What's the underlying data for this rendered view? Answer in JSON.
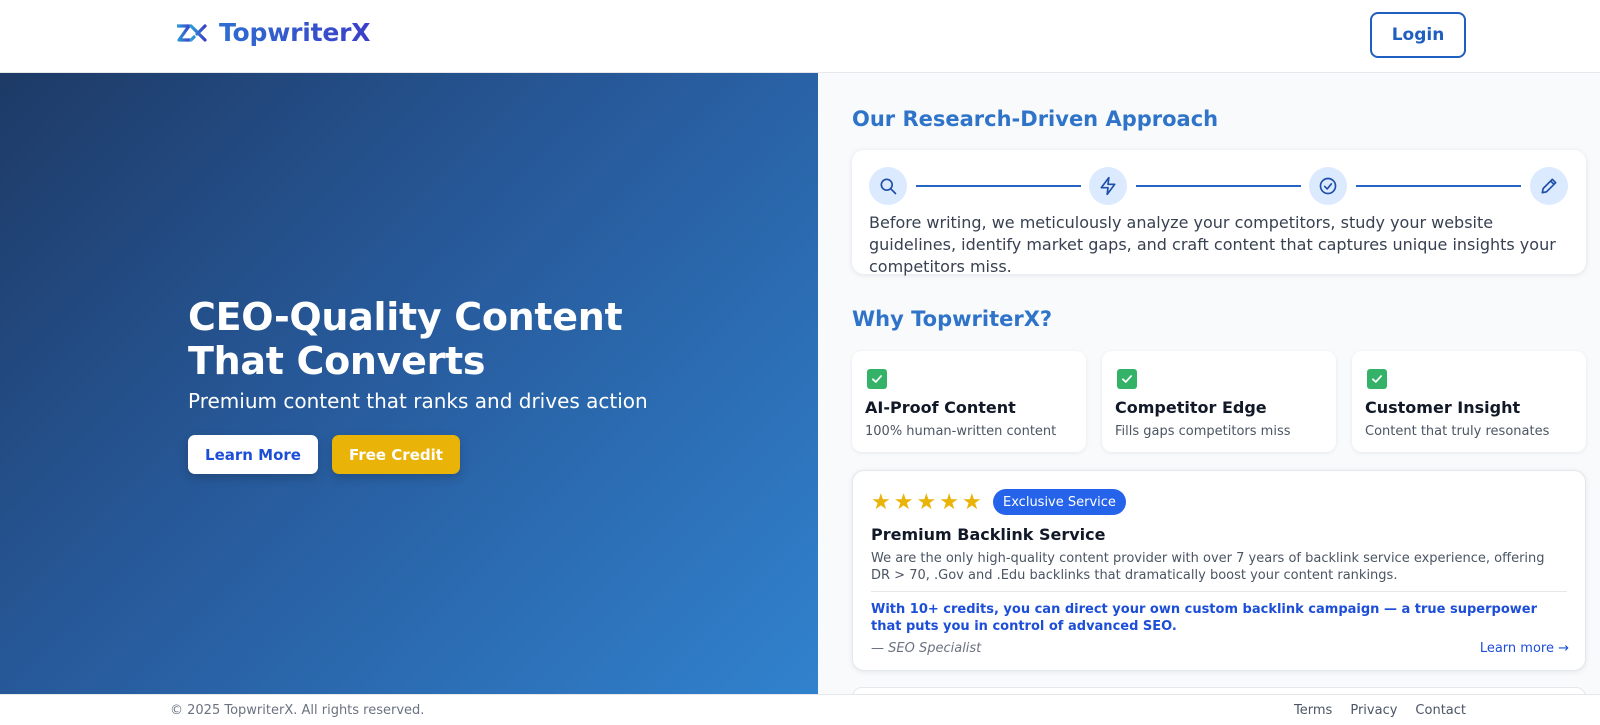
{
  "header": {
    "brand": "TopwriterX",
    "login_label": "Login"
  },
  "hero": {
    "title": "CEO-Quality Content That Converts",
    "subtitle": "Premium content that ranks and drives action",
    "learn_more_label": "Learn More",
    "free_credit_label": "Free Credit"
  },
  "approach": {
    "title": "Our Research-Driven Approach",
    "steps": [
      {
        "icon": "search-icon"
      },
      {
        "icon": "lightning-icon"
      },
      {
        "icon": "check-circle-icon"
      },
      {
        "icon": "pencil-icon"
      }
    ],
    "text": "Before writing, we meticulously analyze your competitors, study your website guidelines, identify market gaps, and craft content that captures unique insights your competitors miss."
  },
  "why": {
    "title": "Why TopwriterX?",
    "features": [
      {
        "title": "AI-Proof Content",
        "desc": "100% human-written content"
      },
      {
        "title": "Competitor Edge",
        "desc": "Fills gaps competitors miss"
      },
      {
        "title": "Customer Insight",
        "desc": "Content that truly resonates"
      }
    ]
  },
  "backlink": {
    "rating": 5,
    "badge": "Exclusive Service",
    "title": "Premium Backlink Service",
    "desc": "We are the only high-quality content provider with over 7 years of backlink service experience, offering DR > 70, .Gov and .Edu backlinks that dramatically boost your content rankings.",
    "quote": "With 10+ credits, you can direct your own custom backlink campaign — a true superpower that puts you in control of advanced SEO.",
    "author": "— SEO Specialist",
    "learn_more": "Learn more →"
  },
  "footer": {
    "copyright": "© 2025 TopwriterX. All rights reserved.",
    "links": [
      "Terms",
      "Privacy",
      "Contact"
    ]
  },
  "colors": {
    "brand_blue": "#2f74c8",
    "accent_yellow": "#eab308",
    "check_green": "#34b368",
    "badge_blue": "#2563eb"
  }
}
